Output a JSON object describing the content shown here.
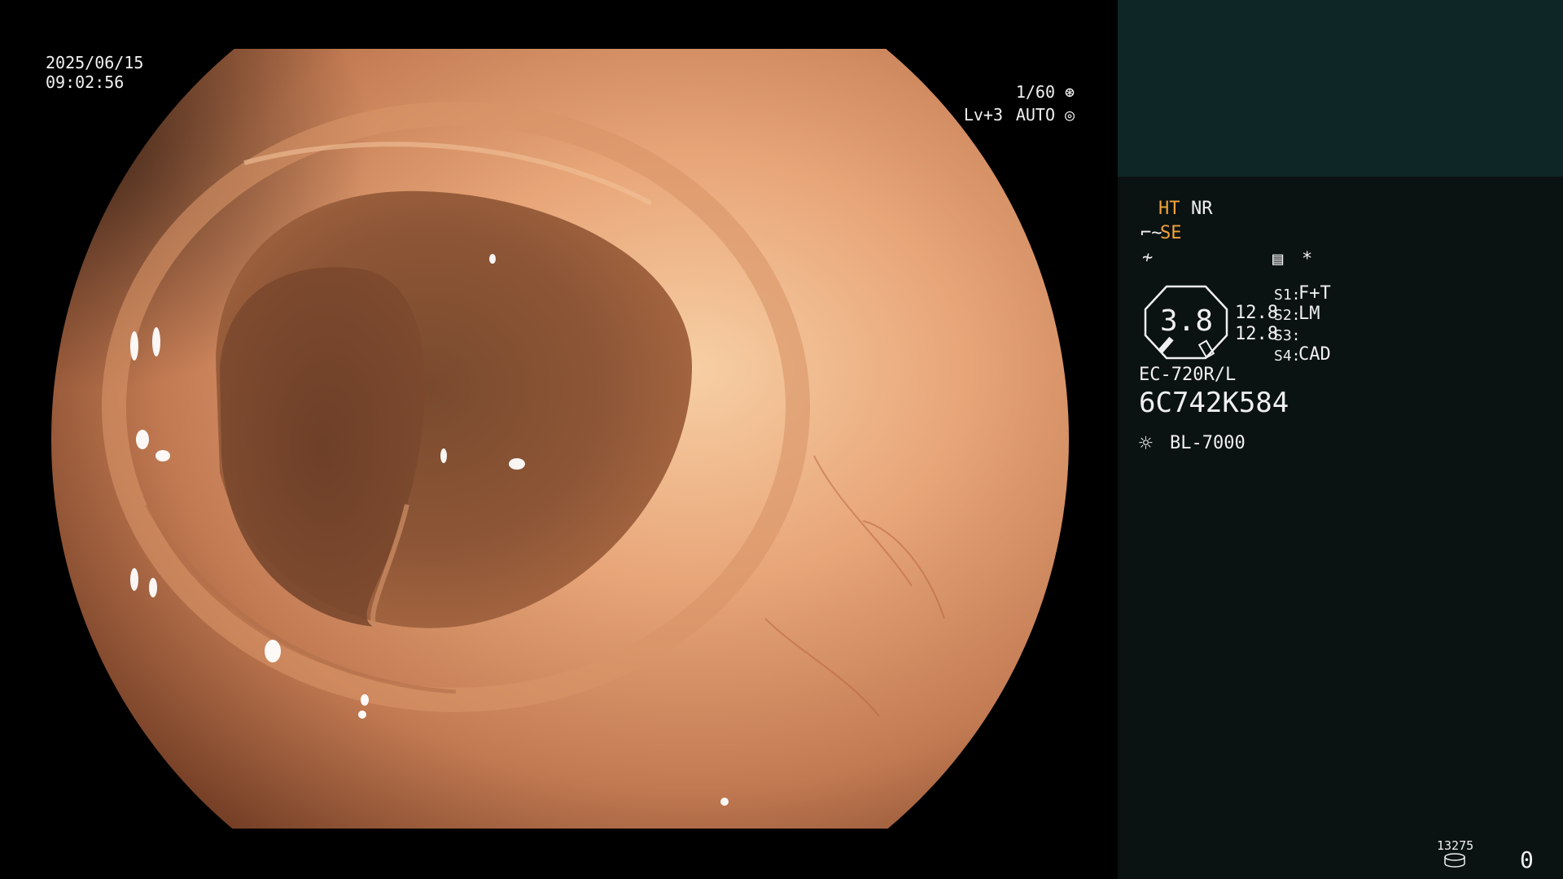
{
  "screen": {
    "date": "2025/06/15",
    "time": "09:02:56",
    "shutter": "1/60",
    "level": "Lv+3",
    "iris_mode": "AUTO"
  },
  "panel": {
    "ht": "HT",
    "nr": "NR",
    "se": "SE",
    "asterisk": "*",
    "gauge_value": "3.8",
    "value_1": "12.8",
    "value_2": "12.8",
    "switches": [
      {
        "key": "S1:",
        "value": "F+T"
      },
      {
        "key": "S2:",
        "value": "LM"
      },
      {
        "key": "S3:",
        "value": ""
      },
      {
        "key": "S4:",
        "value": "CAD"
      }
    ],
    "scope_model": "EC-720R/L",
    "serial": "6C742K584",
    "light_source": "BL-7000",
    "storage_count": "13275",
    "capture_count": "0"
  },
  "colors": {
    "accent_orange": "#f1a33a",
    "panel_bg": "#0b1212",
    "panel_top_bg": "#0f2626"
  }
}
